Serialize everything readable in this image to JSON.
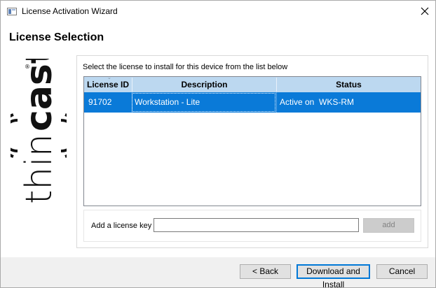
{
  "window": {
    "title": "License Activation Wizard",
    "close_glyph": "×"
  },
  "header": {
    "title": "License Selection"
  },
  "logo": {
    "text": "thincast",
    "registered": "®",
    "icon": "thincast-logo"
  },
  "panel": {
    "instruction": "Select the license to install for this device from the list below",
    "list": {
      "columns": [
        "License ID",
        "Description",
        "Status"
      ],
      "rows": [
        {
          "license_id": "91702",
          "description": "Workstation - Lite",
          "status": "Active on  WKS-RM",
          "selected": true
        }
      ]
    },
    "license_key": {
      "label": "Add a license key",
      "value": "",
      "add_label": "add"
    }
  },
  "footer": {
    "back_label": "< Back",
    "download_label": "Download and Install",
    "cancel_label": "Cancel"
  },
  "colors": {
    "selection": "#0a7ad8",
    "header_bg": "#bcd8f0",
    "footer_bg": "#f0f0f0",
    "default_button_border": "#0078d7"
  }
}
